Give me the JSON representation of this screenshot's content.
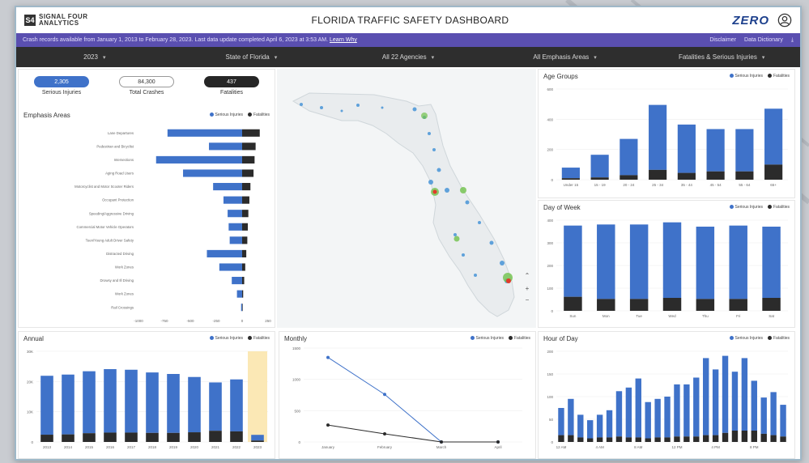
{
  "header": {
    "logo_text_1": "SIGNAL FOUR",
    "logo_text_2": "ANALYTICS",
    "title": "FLORIDA TRAFFIC SAFETY DASHBOARD",
    "zero_logo": "ZERO",
    "user_icon": "user-circle-icon"
  },
  "notice": {
    "text": "Crash records available from January 1, 2013 to February 28, 2023. Last data update completed April 6, 2023 at 3:53 AM.",
    "link": "Learn Why",
    "disclaimer": "Disclaimer",
    "dictionary": "Data Dictionary"
  },
  "filters": [
    {
      "label": "2023"
    },
    {
      "label": "State of Florida"
    },
    {
      "label": "All 22 Agencies"
    },
    {
      "label": "All Emphasis Areas"
    },
    {
      "label": "Fatalities & Serious Injuries"
    }
  ],
  "kpis": [
    {
      "value": "2,305",
      "label": "Serious Injuries",
      "bg": "#3f72c9",
      "fg": "#ffffff"
    },
    {
      "value": "84,300",
      "label": "Total Crashes",
      "bg": "#ffffff",
      "fg": "#333333"
    },
    {
      "value": "437",
      "label": "Fatalities",
      "bg": "#262626",
      "fg": "#ffffff"
    }
  ],
  "legend": {
    "serious": "Serious Injuries",
    "fatal": "Fatalities"
  },
  "colors": {
    "serious": "#3f72c9",
    "fatal": "#2b2b2b",
    "highlight": "#fbe8b5"
  },
  "chart_data": [
    {
      "id": "emphasis",
      "type": "bar",
      "orientation": "horizontal",
      "title": "Emphasis Areas",
      "categories": [
        "Lane Departures",
        "Pedestrian and Bicyclist",
        "Intersections",
        "Aging Road Users",
        "Motorcyclist and Motor Scooter Riders",
        "Occupant Protection",
        "Speeding/Aggressive Driving",
        "Commercial Motor Vehicle Operators",
        "Teen/Young Adult Driver Safety",
        "Distracted Driving",
        "Work Zones",
        "Drowsy and Ill Driving",
        "Work Zones",
        "Rail Crossings"
      ],
      "series": [
        {
          "name": "Serious Injuries",
          "values": [
            -720,
            -320,
            -830,
            -570,
            -280,
            -180,
            -140,
            -130,
            -120,
            -340,
            -220,
            -100,
            -50,
            -10
          ]
        },
        {
          "name": "Fatalities",
          "values": [
            170,
            130,
            120,
            110,
            80,
            70,
            60,
            55,
            50,
            40,
            30,
            20,
            10,
            5
          ]
        }
      ],
      "xticks": [
        "-1000",
        "-750",
        "-500",
        "-250",
        "0",
        "250"
      ],
      "xlim": [
        -1000,
        250
      ]
    },
    {
      "id": "age",
      "type": "bar",
      "title": "Age Groups",
      "categories": [
        "Under 15",
        "15 - 19",
        "20 - 24",
        "25 - 34",
        "35 - 44",
        "45 - 54",
        "55 - 64",
        "65+"
      ],
      "series": [
        {
          "name": "Serious Injuries",
          "values": [
            70,
            150,
            240,
            430,
            320,
            280,
            280,
            370
          ]
        },
        {
          "name": "Fatalities",
          "values": [
            10,
            15,
            30,
            65,
            45,
            55,
            55,
            100
          ]
        }
      ],
      "yticks": [
        "0",
        "200",
        "400",
        "600"
      ],
      "ylim": [
        0,
        600
      ]
    },
    {
      "id": "dow",
      "type": "bar",
      "title": "Day of Week",
      "categories": [
        "Sun",
        "Mon",
        "Tue",
        "Wed",
        "Thu",
        "Fri",
        "Sat"
      ],
      "series": [
        {
          "name": "Serious Injuries",
          "values": [
            330,
            345,
            345,
            350,
            335,
            340,
            330
          ]
        },
        {
          "name": "Fatalities",
          "values": [
            65,
            55,
            55,
            60,
            55,
            55,
            60
          ]
        }
      ],
      "yticks": [
        "0",
        "100",
        "200",
        "300",
        "400"
      ],
      "ylim": [
        0,
        420
      ]
    },
    {
      "id": "annual",
      "type": "bar",
      "title": "Annual",
      "categories": [
        "2013",
        "2014",
        "2015",
        "2016",
        "2017",
        "2018",
        "2019",
        "2020",
        "2021",
        "2022",
        "2023"
      ],
      "series": [
        {
          "name": "Serious Injuries",
          "values": [
            19500,
            19800,
            20500,
            21000,
            20800,
            20000,
            19500,
            18300,
            16000,
            17200,
            1900
          ]
        },
        {
          "name": "Fatalities",
          "values": [
            2400,
            2500,
            2900,
            3100,
            3100,
            3000,
            3000,
            3200,
            3700,
            3500,
            450
          ]
        }
      ],
      "highlight_index": 10,
      "yticks": [
        "0",
        "10K",
        "20K",
        "30K"
      ],
      "ylim": [
        0,
        30000
      ]
    },
    {
      "id": "monthly",
      "type": "line",
      "title": "Monthly",
      "categories": [
        "January",
        "February",
        "March",
        "April"
      ],
      "series": [
        {
          "name": "Serious Injuries",
          "values": [
            1350,
            760,
            0,
            0
          ]
        },
        {
          "name": "Fatalities",
          "values": [
            270,
            130,
            0,
            0
          ]
        }
      ],
      "yticks": [
        "0",
        "500",
        "1000",
        "1500"
      ],
      "ylim": [
        0,
        1500
      ]
    },
    {
      "id": "hour",
      "type": "bar",
      "title": "Hour of Day",
      "categories": [
        "0",
        "1",
        "2",
        "3",
        "4",
        "5",
        "6",
        "7",
        "8",
        "9",
        "10",
        "11",
        "12",
        "13",
        "14",
        "15",
        "16",
        "17",
        "18",
        "19",
        "20",
        "21",
        "22",
        "23"
      ],
      "series": [
        {
          "name": "Serious Injuries",
          "values": [
            60,
            80,
            50,
            40,
            50,
            60,
            100,
            110,
            130,
            80,
            85,
            90,
            115,
            115,
            130,
            170,
            145,
            170,
            130,
            160,
            110,
            80,
            95,
            70
          ]
        },
        {
          "name": "Fatalities",
          "values": [
            15,
            15,
            10,
            8,
            10,
            10,
            12,
            10,
            10,
            8,
            10,
            10,
            12,
            12,
            12,
            15,
            15,
            20,
            25,
            25,
            25,
            18,
            15,
            12
          ]
        }
      ],
      "xticks": [
        "12 AM",
        "4 AM",
        "8 AM",
        "12 PM",
        "4 PM",
        "8 PM"
      ],
      "yticks": [
        "0",
        "50",
        "100",
        "150",
        "200"
      ],
      "ylim": [
        0,
        200
      ]
    }
  ]
}
